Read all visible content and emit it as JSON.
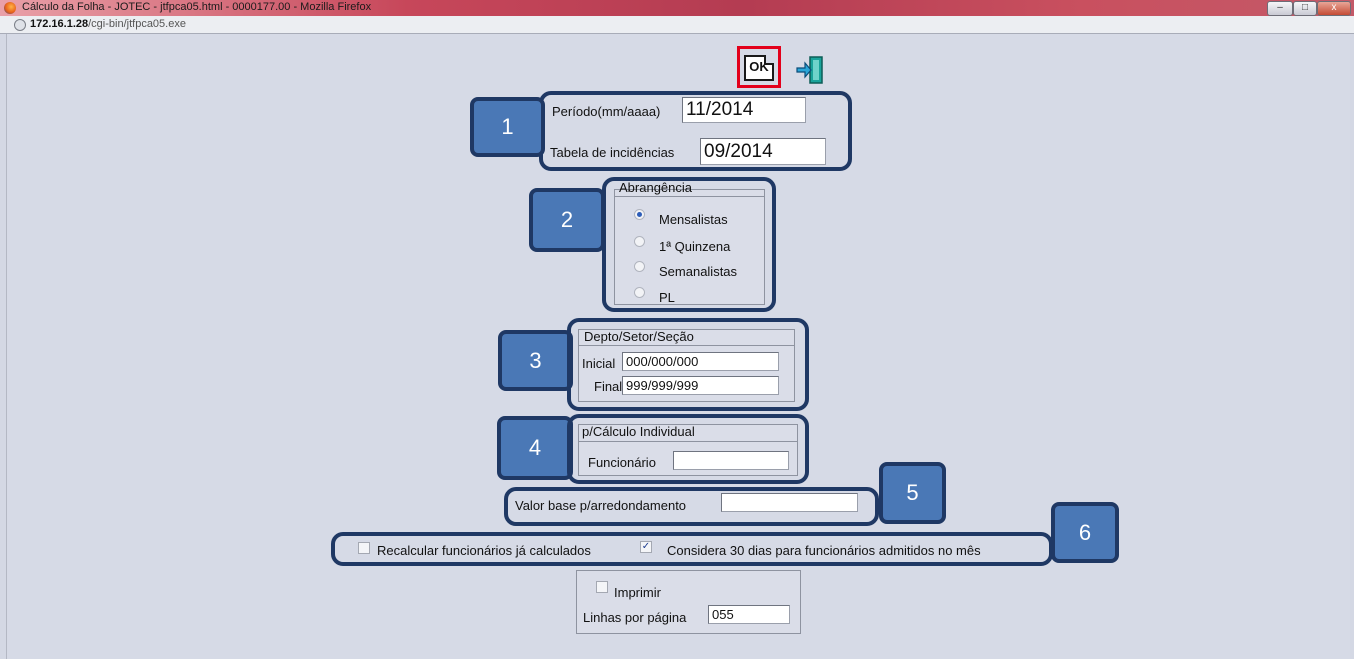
{
  "window": {
    "title": "Cálculo da Folha - JOTEC - jtfpca05.html - 0000177.00 - Mozilla Firefox",
    "minimize": "–",
    "maximize": "□",
    "close": "x"
  },
  "urlbar": {
    "host": "172.16.1.28",
    "path": "/cgi-bin/jtfpca05.exe"
  },
  "toolbar": {
    "ok_label": "OK",
    "ok_icon": "ok-document-icon",
    "exit_icon": "exit-door-icon"
  },
  "fields": {
    "periodo_label": "Período(mm/aaaa)",
    "periodo_value": "11/2014",
    "tabela_label": "Tabela de incidências",
    "tabela_value": "09/2014"
  },
  "abrangencia": {
    "legend": "Abrangência",
    "options": [
      "Mensalistas",
      "1ª Quinzena",
      "Semanalistas",
      "PL"
    ],
    "selected": "Mensalistas"
  },
  "depto": {
    "legend": "Depto/Setor/Seção",
    "inicial_label": "Inicial",
    "inicial_value": "000/000/000",
    "final_label": "Final",
    "final_value": "999/999/999"
  },
  "individual": {
    "legend": "p/Cálculo Individual",
    "funcionario_label": "Funcionário",
    "funcionario_value": ""
  },
  "arredondamento": {
    "label": "Valor base p/arredondamento",
    "value": ""
  },
  "options": {
    "recalcular_label": "Recalcular funcionários já calculados",
    "recalcular_checked": false,
    "considera_label": "Considera 30 dias para funcionários admitidos no mês",
    "considera_checked": true
  },
  "impressao": {
    "imprimir_label": "Imprimir",
    "imprimir_checked": false,
    "linhas_label": "Linhas por página",
    "linhas_value": "055"
  },
  "badges": [
    "1",
    "2",
    "3",
    "4",
    "5",
    "6"
  ],
  "colors": {
    "highlight_border": "#1f3864",
    "badge_fill": "#4a78b6",
    "ok_highlight": "#e3001b"
  }
}
